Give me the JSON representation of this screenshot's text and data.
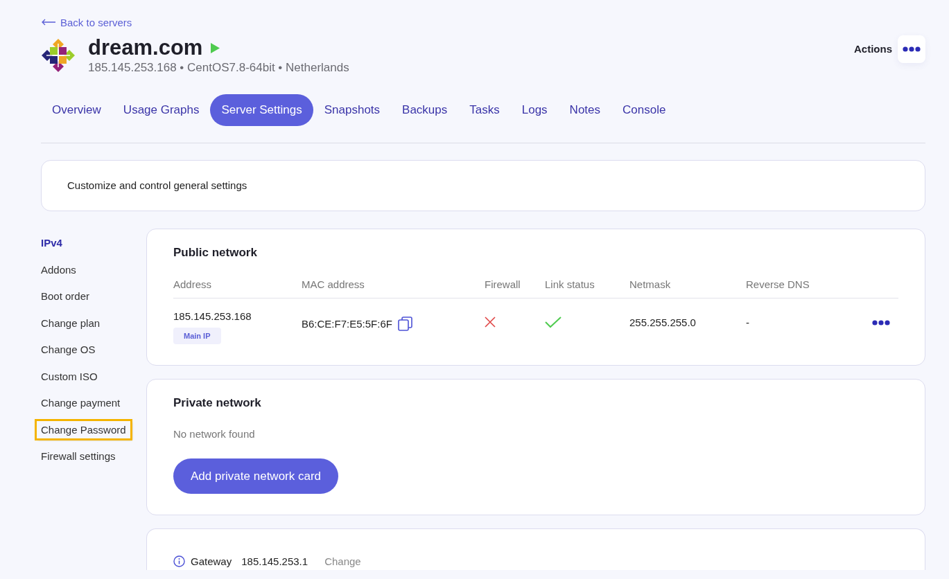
{
  "back_link": {
    "label": "Back to servers"
  },
  "server": {
    "name": "dream.com",
    "running": true,
    "details": "185.145.253.168 • CentOS7.8-64bit • Netherlands"
  },
  "actions": {
    "label": "Actions"
  },
  "tabs": [
    {
      "label": "Overview",
      "selected": false
    },
    {
      "label": "Usage Graphs",
      "selected": false
    },
    {
      "label": "Server Settings",
      "selected": true
    },
    {
      "label": "Snapshots",
      "selected": false
    },
    {
      "label": "Backups",
      "selected": false
    },
    {
      "label": "Tasks",
      "selected": false
    },
    {
      "label": "Logs",
      "selected": false
    },
    {
      "label": "Notes",
      "selected": false
    },
    {
      "label": "Console",
      "selected": false
    }
  ],
  "intro": {
    "text": "Customize and control general settings"
  },
  "sidebar": {
    "items": [
      {
        "label": "IPv4",
        "selected": true,
        "highlighted": false
      },
      {
        "label": "Addons",
        "selected": false,
        "highlighted": false
      },
      {
        "label": "Boot order",
        "selected": false,
        "highlighted": false
      },
      {
        "label": "Change plan",
        "selected": false,
        "highlighted": false
      },
      {
        "label": "Change OS",
        "selected": false,
        "highlighted": false
      },
      {
        "label": "Custom ISO",
        "selected": false,
        "highlighted": false
      },
      {
        "label": "Change payment",
        "selected": false,
        "highlighted": false
      },
      {
        "label": "Change Password",
        "selected": false,
        "highlighted": true
      },
      {
        "label": "Firewall settings",
        "selected": false,
        "highlighted": false
      }
    ]
  },
  "public_network": {
    "title": "Public network",
    "columns": [
      "Address",
      "MAC address",
      "Firewall",
      "Link status",
      "Netmask",
      "Reverse DNS"
    ],
    "rows": [
      {
        "address": "185.145.253.168",
        "badge": "Main IP",
        "mac": "B6:CE:F7:E5:5F:6F",
        "firewall": false,
        "link_up": true,
        "netmask": "255.255.255.0",
        "reverse_dns": "-"
      }
    ]
  },
  "private_network": {
    "title": "Private network",
    "empty_text": "No network found",
    "button": "Add private network card"
  },
  "gateway": {
    "label": "Gateway",
    "value": "185.145.253.1",
    "action": "Change"
  }
}
